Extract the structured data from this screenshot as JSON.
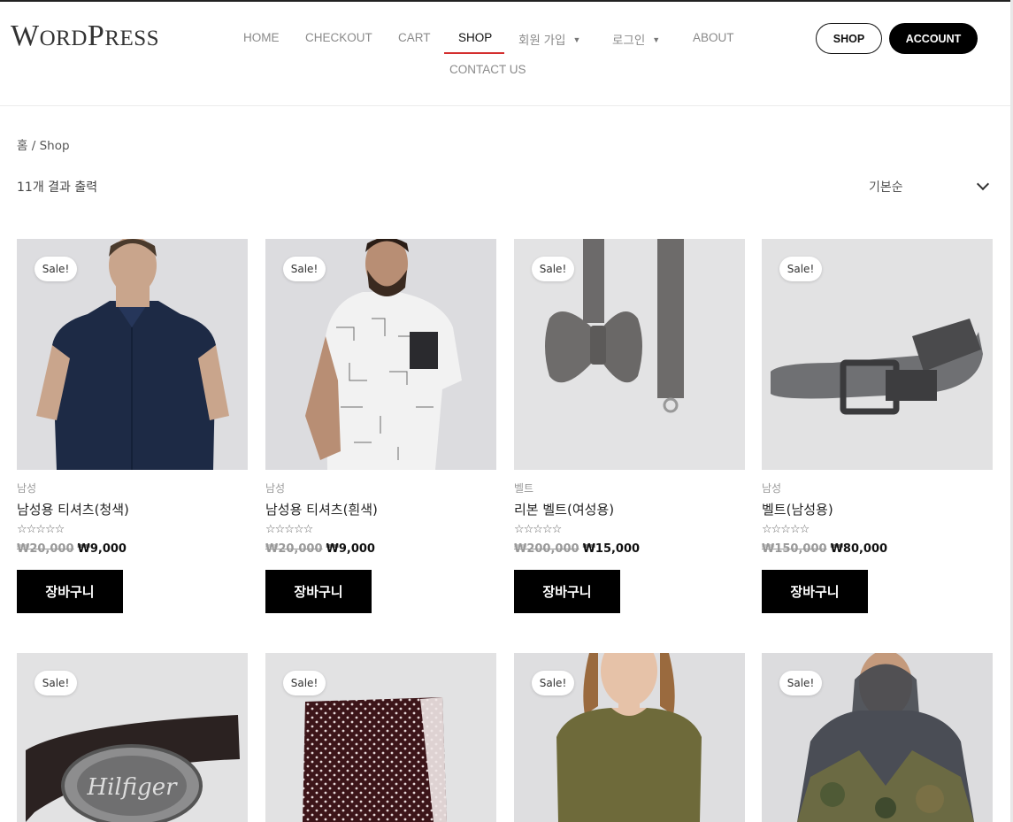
{
  "site": {
    "logo": "WordPress"
  },
  "nav": {
    "home": "HOME",
    "checkout": "CHECKOUT",
    "cart": "CART",
    "shop": "SHOP",
    "signup": "회원 가입",
    "login": "로그인",
    "about": "ABOUT",
    "contact": "CONTACT US"
  },
  "header_buttons": {
    "shop": "SHOP",
    "account": "ACCOUNT"
  },
  "breadcrumb": {
    "home": "홈",
    "separator": " / ",
    "current": "Shop"
  },
  "result_count": "11개 결과 출력",
  "orderby": {
    "selected": "기본순"
  },
  "sale_badge": "Sale!",
  "add_to_cart": "장바구니",
  "stars": "☆☆☆☆☆",
  "products": [
    {
      "category": "남성",
      "title": "남성용 티셔츠(청색)",
      "old_price": "₩20,000",
      "price": "₩9,000",
      "image": "navy-shirt-model"
    },
    {
      "category": "남성",
      "title": "남성용 티셔츠(흰색)",
      "old_price": "₩20,000",
      "price": "₩9,000",
      "image": "white-tshirt-model"
    },
    {
      "category": "벨트",
      "title": "리본 벨트(여성용)",
      "old_price": "₩200,000",
      "price": "₩15,000",
      "image": "grey-bowtie"
    },
    {
      "category": "남성",
      "title": "벨트(남성용)",
      "old_price": "₩150,000",
      "price": "₩80,000",
      "image": "grey-canvas-belt"
    },
    {
      "image": "hilfiger-buckle-belt",
      "buckle_text": "Hilfiger"
    },
    {
      "image": "dotted-pocket-square"
    },
    {
      "image": "olive-tshirt-woman"
    },
    {
      "image": "camo-windbreaker-man"
    }
  ],
  "colors": {
    "accent": "#d42e2e",
    "button": "#000000",
    "image_bg": "#dcdcde"
  }
}
